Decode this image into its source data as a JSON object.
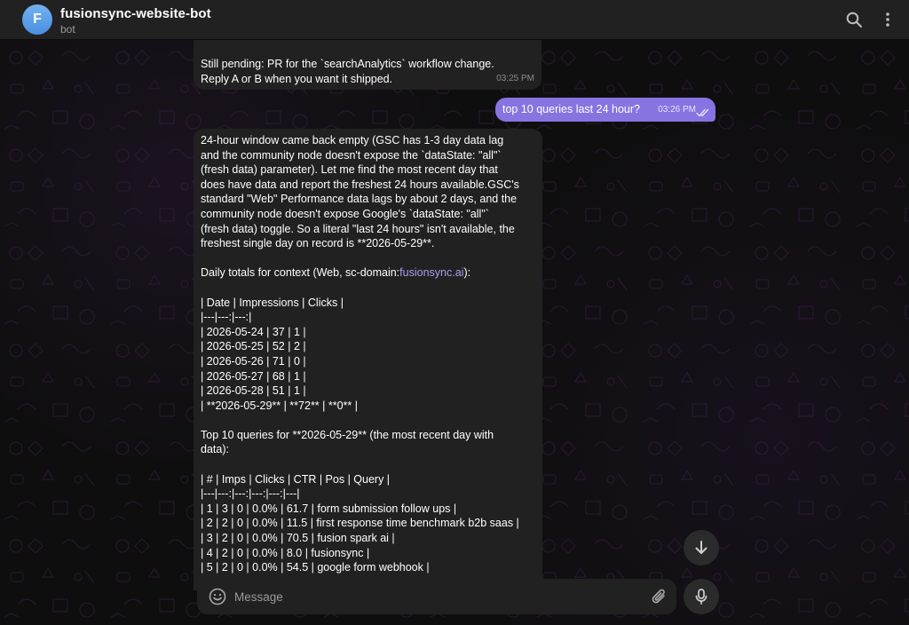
{
  "header": {
    "avatar_letter": "F",
    "avatar_color": "#5fa3ec",
    "title": "fusionsync-website-bot",
    "subtitle": "bot",
    "icons": [
      "search-icon",
      "more-vertical-icon"
    ]
  },
  "colors": {
    "outgoing_bubble": "#8774e1",
    "incoming_bubble": "#212121",
    "link": "#a89ff0",
    "background": "#0e0e0e"
  },
  "messages": [
    {
      "direction": "incoming",
      "lines": [
        "Still pending: PR for the `searchAnalytics` workflow change.",
        "Reply A or B when you want it shipped."
      ],
      "time": "03:25 PM"
    },
    {
      "direction": "outgoing",
      "text": "top 10 queries last 24 hour?",
      "time": "03:26 PM",
      "status": "read"
    },
    {
      "direction": "incoming",
      "lines": [
        "24-hour window came back empty (GSC has 1-3 day data lag",
        "and the community node doesn't expose the `dataState: \"all\"`",
        "(fresh data) parameter). Let me find the most recent day that",
        "does have data and report the freshest 24 hours available.GSC's",
        "standard \"Web\" Performance data lags by about 2 days, and the",
        "community node doesn't expose Google's `dataState: \"all\"`",
        "(fresh data) toggle. So a literal \"last 24 hours\" isn't available, the",
        "freshest single day on record is **2026-05-29**.",
        "",
        "Daily totals for context (Web, sc-domain:",
        "",
        "| Date | Impressions | Clicks |",
        "|---|---:|---:|",
        "| 2026-05-24 | 37 | 1 |",
        "| 2026-05-25 | 52 | 2 |",
        "| 2026-05-26 | 71 | 0 |",
        "| 2026-05-27 | 68 | 1 |",
        "| 2026-05-28 | 51 | 1 |",
        "| **2026-05-29** | **72** | **0** |",
        "",
        "Top 10 queries for **2026-05-29** (the most recent day with",
        "data):",
        "",
        "| # | Imps | Clicks | CTR | Pos | Query |",
        "|---|---:|---:|---:|---:|---|",
        "| 1 | 3 | 0 | 0.0% | 61.7 | form submission follow ups |",
        "| 2 | 2 | 0 | 0.0% | 11.5 | first response time benchmark b2b saas |",
        "| 3 | 2 | 0 | 0.0% | 70.5 | fusion spark ai |",
        "| 4 | 2 | 0 | 0.0% | 8.0 | fusionsync |",
        "| 5 | 2 | 0 | 0.0% | 54.5 | google form webhook |"
      ],
      "link_text": "fusionsync.ai",
      "link_suffix": "):"
    }
  ],
  "composer": {
    "placeholder": "Message",
    "icons": [
      "emoji-icon",
      "paperclip-icon",
      "microphone-icon"
    ]
  },
  "scroll_button_icon": "arrow-down-icon"
}
